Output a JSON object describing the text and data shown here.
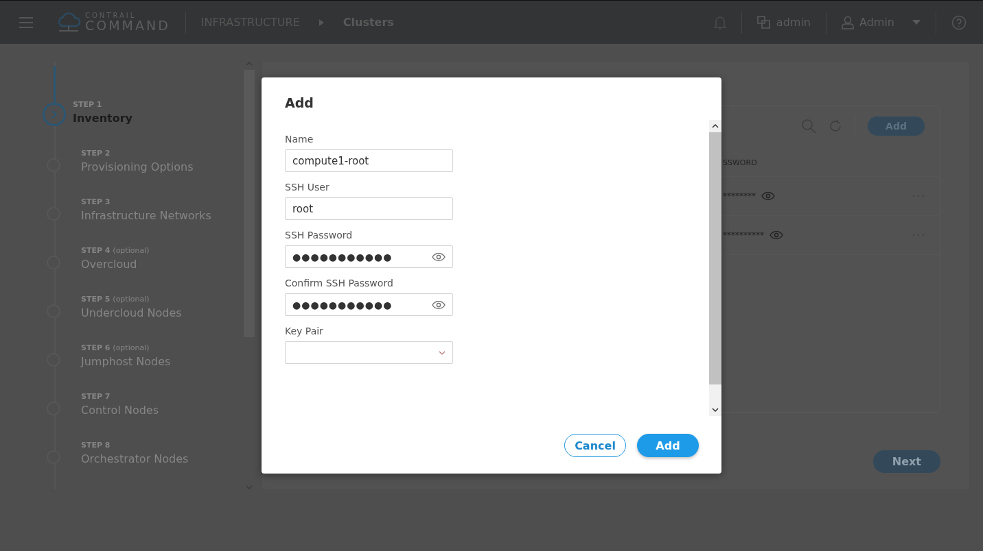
{
  "header": {
    "logo_top": "CONTRAIL",
    "logo_bottom": "COMMAND",
    "breadcrumb": [
      "INFRASTRUCTURE",
      "Clusters"
    ],
    "tenant": "admin",
    "user": "Admin"
  },
  "steps": [
    {
      "step": "STEP 1",
      "title": "Inventory",
      "selected": true
    },
    {
      "step": "STEP 2",
      "title": "Provisioning Options",
      "selected": false
    },
    {
      "step": "STEP 3",
      "title": "Infrastructure Networks",
      "selected": false
    },
    {
      "step": "STEP 4",
      "optional": "(optional)",
      "title": "Overcloud",
      "selected": false
    },
    {
      "step": "STEP 5",
      "optional": "(optional)",
      "title": "Undercloud Nodes",
      "selected": false
    },
    {
      "step": "STEP 6",
      "optional": "(optional)",
      "title": "Jumphost Nodes",
      "selected": false
    },
    {
      "step": "STEP 7",
      "title": "Control Nodes",
      "selected": false
    },
    {
      "step": "STEP 8",
      "title": "Orchestrator Nodes",
      "selected": false
    }
  ],
  "background_card": {
    "add_button": "Add",
    "column_header": "SSWORD",
    "rows": [
      {
        "password": "********"
      },
      {
        "password": "**********"
      }
    ],
    "next_button": "Next"
  },
  "dialog": {
    "title": "Add",
    "fields": [
      {
        "kind": "text",
        "label": "Name",
        "value": "compute1-root"
      },
      {
        "kind": "text",
        "label": "SSH User",
        "value": "root"
      },
      {
        "kind": "password",
        "label": "SSH Password",
        "value": "●●●●●●●●●●●"
      },
      {
        "kind": "password",
        "label": "Confirm SSH Password",
        "value": "●●●●●●●●●●●"
      },
      {
        "kind": "select",
        "label": "Key Pair"
      }
    ],
    "buttons": [
      {
        "kind": "secondary",
        "label": "Cancel"
      },
      {
        "kind": "primary",
        "label": "Add"
      }
    ]
  }
}
